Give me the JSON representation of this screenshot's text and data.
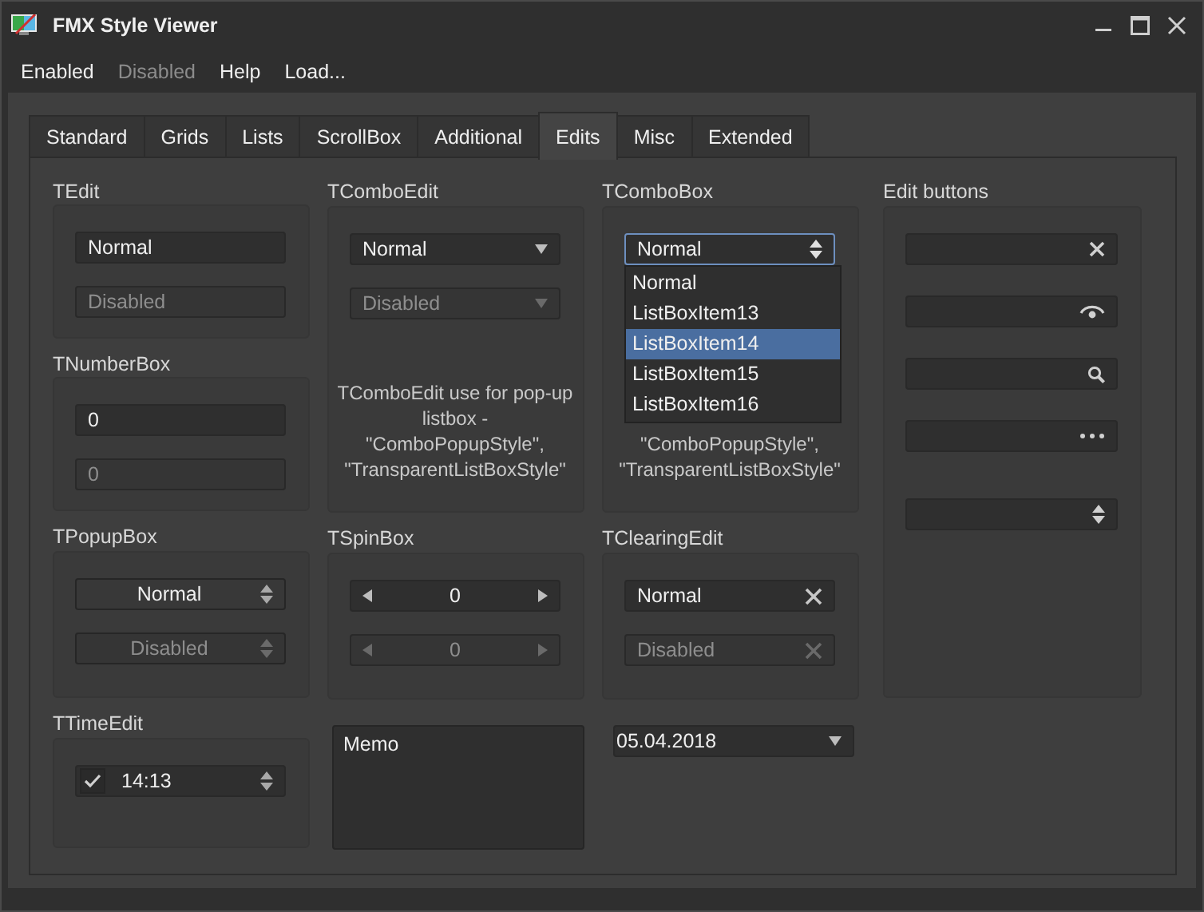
{
  "window": {
    "title": "FMX Style Viewer"
  },
  "menu": [
    {
      "label": "Enabled",
      "disabled": false
    },
    {
      "label": "Disabled",
      "disabled": true
    },
    {
      "label": "Help",
      "disabled": false
    },
    {
      "label": "Load...",
      "disabled": false
    }
  ],
  "tabs": [
    {
      "label": "Standard",
      "selected": false
    },
    {
      "label": "Grids",
      "selected": false
    },
    {
      "label": "Lists",
      "selected": false
    },
    {
      "label": "ScrollBox",
      "selected": false
    },
    {
      "label": "Additional",
      "selected": false
    },
    {
      "label": "Edits",
      "selected": true
    },
    {
      "label": "Misc",
      "selected": false
    },
    {
      "label": "Extended",
      "selected": false
    }
  ],
  "columns": [
    [
      {
        "kind": "group",
        "title": "TEdit",
        "fields": [
          {
            "kind": "edit",
            "value": "Normal",
            "disabled": false
          },
          {
            "kind": "edit",
            "value": "Disabled",
            "disabled": true
          }
        ]
      },
      {
        "kind": "group",
        "title": "TNumberBox",
        "fields": [
          {
            "kind": "edit",
            "value": "0",
            "disabled": false
          },
          {
            "kind": "edit",
            "value": "0",
            "disabled": true
          }
        ]
      },
      {
        "kind": "group",
        "title": "TPopupBox",
        "fields": [
          {
            "kind": "popup",
            "value": "Normal",
            "disabled": false
          },
          {
            "kind": "popup",
            "value": "Disabled",
            "disabled": true
          }
        ]
      },
      {
        "kind": "group",
        "title": "TTimeEdit",
        "fields": [
          {
            "kind": "time",
            "value": "14:13",
            "checked": true,
            "disabled": false
          }
        ]
      }
    ],
    [
      {
        "kind": "group",
        "title": "TComboEdit",
        "fields": [
          {
            "kind": "comboedit",
            "value": "Normal",
            "disabled": false
          },
          {
            "kind": "comboedit",
            "value": "Disabled",
            "disabled": true
          }
        ],
        "note": [
          "TComboEdit use for pop-up",
          "listbox -",
          "\"ComboPopupStyle\",",
          "\"TransparentListBoxStyle\""
        ]
      },
      {
        "kind": "group",
        "title": "TSpinBox",
        "fields": [
          {
            "kind": "spin",
            "value": "0",
            "disabled": false
          },
          {
            "kind": "spin",
            "value": "0",
            "disabled": true
          }
        ]
      },
      {
        "kind": "plain",
        "fields": [
          {
            "kind": "memo",
            "value": "Memo"
          }
        ]
      }
    ],
    [
      {
        "kind": "group",
        "title": "TComboBox",
        "fields": [
          {
            "kind": "combobox",
            "value": "Normal",
            "focused": true,
            "disabled": false
          }
        ],
        "dropdown": [
          {
            "label": "Normal",
            "selected": false
          },
          {
            "label": "ListBoxItem13",
            "selected": false
          },
          {
            "label": "ListBoxItem14",
            "selected": true
          },
          {
            "label": "ListBoxItem15",
            "selected": false
          },
          {
            "label": "ListBoxItem16",
            "selected": false
          }
        ],
        "note": [
          "\"ComboPopupStyle\",",
          "\"TransparentListBoxStyle\""
        ]
      },
      {
        "kind": "group",
        "title": "TClearingEdit",
        "fields": [
          {
            "kind": "clearing",
            "value": "Normal",
            "disabled": false
          },
          {
            "kind": "clearing",
            "value": "Disabled",
            "disabled": true
          }
        ]
      },
      {
        "kind": "plain",
        "fields": [
          {
            "kind": "date",
            "value": "05.04.2018",
            "disabled": false
          }
        ]
      }
    ],
    [
      {
        "kind": "group",
        "title": "Edit buttons",
        "fields": [
          {
            "kind": "clearbutton"
          },
          {
            "kind": "passwordbutton"
          },
          {
            "kind": "searchbutton"
          },
          {
            "kind": "ellipsisbutton"
          },
          {
            "kind": "spinbutton"
          }
        ]
      }
    ]
  ]
}
